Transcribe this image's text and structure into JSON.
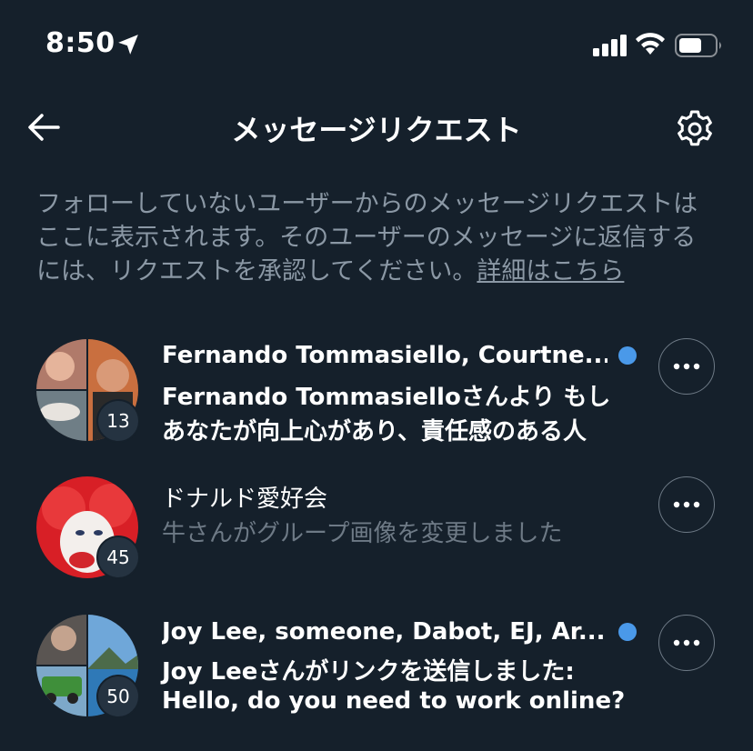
{
  "status_bar": {
    "time": "8:50"
  },
  "header": {
    "title": "メッセージリクエスト"
  },
  "description": {
    "text": "フォローしていないユーザーからのメッセージリクエストはここに表示されます。そのユーザーのメッセージに返信するには、リクエストを承認してください。",
    "link_label": "詳細はこちら"
  },
  "requests": [
    {
      "title": "Fernando Tommasiello, Courtne...",
      "line1": "Fernando Tommasielloさんより もし",
      "line2": "あなたが向上心があり、責任感のある人",
      "count": "13",
      "unread": true
    },
    {
      "title": "ドナルド愛好会",
      "line1": "牛さんがグループ画像を変更しました",
      "count": "45",
      "unread": false
    },
    {
      "title": "Joy Lee, someone, Dabot, EJ, Ar...",
      "line1": "Joy Leeさんがリンクを送信しました:",
      "line2": "Hello, do you need to work online?",
      "count": "50",
      "unread": true
    }
  ],
  "colors": {
    "background": "#15202b",
    "accent": "#4a99e9",
    "secondary_text": "#8b98a5"
  }
}
